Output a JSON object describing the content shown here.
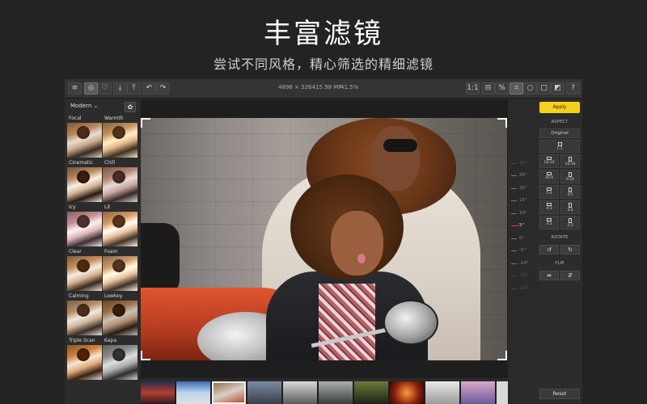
{
  "headline": "丰富滤镜",
  "subheadline": "尝试不同风格，精心筛选的精细滤镜",
  "toolbar": {
    "image_dimensions": "4896 × 3264",
    "megapixels": "15.98 MP",
    "zoom": "41.5%",
    "actual_size_label": "1:1",
    "help_label": "?"
  },
  "left_panel": {
    "preset_dropdown": "Modern",
    "filters": [
      {
        "label": "Focal"
      },
      {
        "label": "Warmth"
      },
      {
        "label": "Cinematic"
      },
      {
        "label": "Chill"
      },
      {
        "label": "Icy"
      },
      {
        "label": "Lit"
      },
      {
        "label": "Clear"
      },
      {
        "label": "Foam"
      },
      {
        "label": "Calming"
      },
      {
        "label": "Lowkey"
      },
      {
        "label": "Triple Scan"
      },
      {
        "label": "Kapa"
      }
    ]
  },
  "rotation_ruler": {
    "ticks": [
      "30°",
      "25°",
      "20°",
      "15°",
      "10°",
      "5°",
      "0°",
      "-5°",
      "-10°",
      "-15°",
      "-20°"
    ],
    "current": "5°"
  },
  "right_panel": {
    "apply_label": "Apply",
    "aspect_label": "ASPECT",
    "original_label": "Original",
    "ratios": [
      "1:1",
      "16:10",
      "10:16",
      "16:9",
      "9:16",
      "5:4",
      "4:5",
      "4:3",
      "3:4",
      "3:2",
      "2:3"
    ],
    "rotate_label": "ROTATE",
    "flip_label": "FLIP",
    "reset_label": "Reset"
  },
  "colors": {
    "background": "#232323",
    "apply_button": "#f6d11c",
    "ruler_current": "#e53935"
  }
}
